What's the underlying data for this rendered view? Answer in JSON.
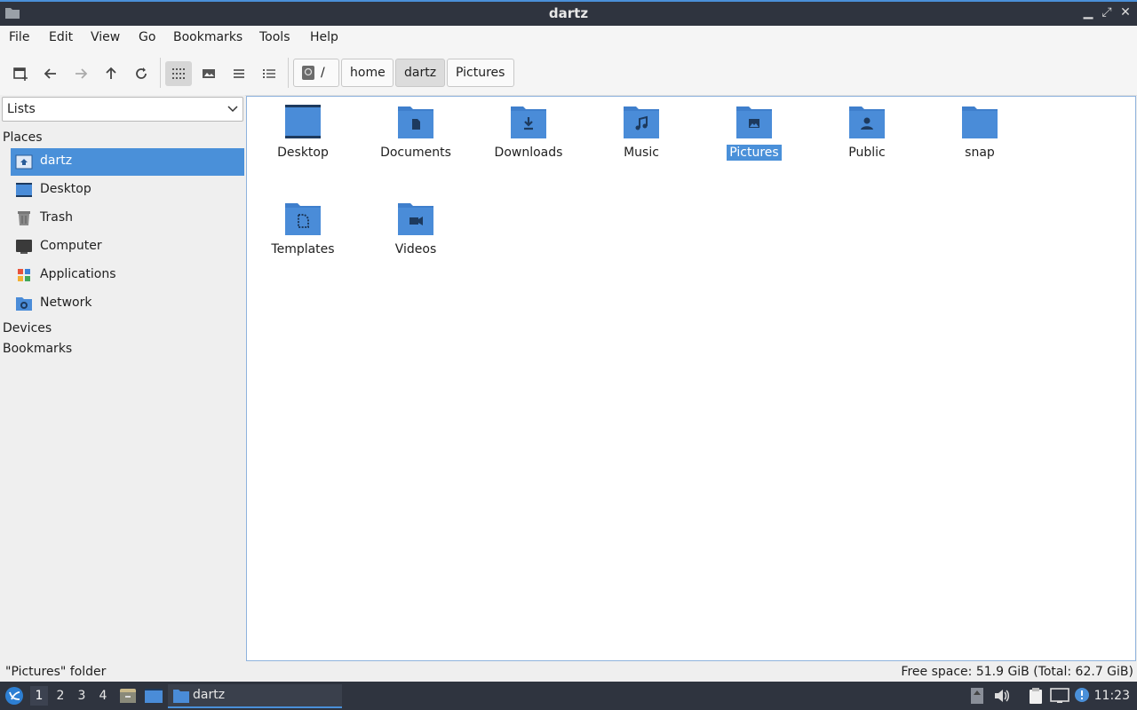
{
  "window": {
    "title": "dartz"
  },
  "menu": [
    "File",
    "Edit",
    "View",
    "Go",
    "Bookmarks",
    "Tools",
    "Help"
  ],
  "breadcrumb": {
    "root": "/",
    "parts": [
      "home",
      "dartz",
      "Pictures"
    ]
  },
  "sidebar": {
    "mode": "Lists",
    "sections": {
      "places": "Places",
      "devices": "Devices",
      "bookmarks": "Bookmarks"
    },
    "places": [
      {
        "label": "dartz",
        "icon": "home-folder-icon",
        "selected": true
      },
      {
        "label": "Desktop",
        "icon": "desktop-icon"
      },
      {
        "label": "Trash",
        "icon": "trash-icon"
      },
      {
        "label": "Computer",
        "icon": "computer-icon"
      },
      {
        "label": "Applications",
        "icon": "applications-icon"
      },
      {
        "label": "Network",
        "icon": "network-icon"
      }
    ]
  },
  "files": [
    {
      "name": "Desktop",
      "icon": "desktop-folder-icon"
    },
    {
      "name": "Documents",
      "icon": "documents-folder-icon"
    },
    {
      "name": "Downloads",
      "icon": "downloads-folder-icon"
    },
    {
      "name": "Music",
      "icon": "music-folder-icon"
    },
    {
      "name": "Pictures",
      "icon": "pictures-folder-icon",
      "selected": true
    },
    {
      "name": "Public",
      "icon": "public-folder-icon"
    },
    {
      "name": "snap",
      "icon": "folder-icon"
    },
    {
      "name": "Templates",
      "icon": "templates-folder-icon"
    },
    {
      "name": "Videos",
      "icon": "videos-folder-icon"
    }
  ],
  "status": {
    "left": "\"Pictures\" folder",
    "right": "Free space: 51.9 GiB (Total: 62.7 GiB)"
  },
  "taskbar": {
    "workspaces": [
      "1",
      "2",
      "3",
      "4"
    ],
    "task_label": "dartz",
    "clock": "11:23"
  },
  "colors": {
    "accent": "#4a90d9",
    "panel": "#2f343f",
    "folder": "#4a8cd8"
  }
}
